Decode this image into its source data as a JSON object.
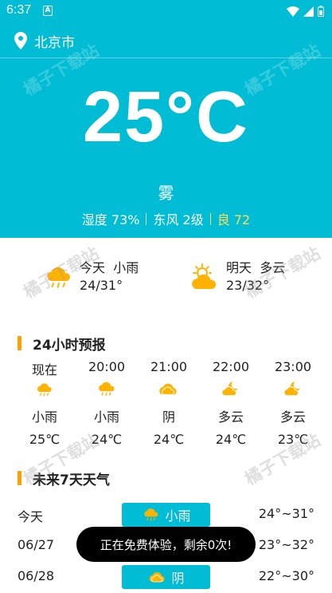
{
  "status_bar": {
    "time": "6:37",
    "notification_letter": "A"
  },
  "header": {
    "city": "北京市",
    "temperature": "25°C",
    "condition": "雾",
    "humidity": "湿度 73%",
    "wind": "东风 2级",
    "aqi": "良 72"
  },
  "forecast_summary": {
    "today": {
      "label": "今天",
      "condition": "小雨",
      "range": "24/31°",
      "icon": "rain-cloud-icon"
    },
    "tomorrow": {
      "label": "明天",
      "condition": "多云",
      "range": "23/32°",
      "icon": "partly-cloudy-sun-icon"
    }
  },
  "hourly": {
    "title": "24小时预报",
    "items": [
      {
        "time": "现在",
        "condition": "小雨",
        "temp": "25℃",
        "icon": "rain-cloud-icon"
      },
      {
        "time": "20:00",
        "condition": "小雨",
        "temp": "24℃",
        "icon": "rain-cloud-icon"
      },
      {
        "time": "21:00",
        "condition": "阴",
        "temp": "24℃",
        "icon": "overcast-cloud-icon"
      },
      {
        "time": "22:00",
        "condition": "多云",
        "temp": "24℃",
        "icon": "partly-cloudy-moon-icon"
      },
      {
        "time": "23:00",
        "condition": "多云",
        "temp": "23℃",
        "icon": "partly-cloudy-moon-icon"
      }
    ]
  },
  "daily": {
    "title": "未来7天天气",
    "items": [
      {
        "date": "今天",
        "condition": "小雨",
        "range": "24°~31°",
        "icon": "rain-cloud-icon"
      },
      {
        "date": "06/27",
        "condition": "",
        "range": "23°~32°",
        "icon": ""
      },
      {
        "date": "06/28",
        "condition": "阴",
        "range": "22°~30°",
        "icon": "overcast-cloud-icon"
      }
    ]
  },
  "toast": {
    "message": "正在免费体验，剩余0次!"
  },
  "watermark": "橘子下载站",
  "colors": {
    "primary": "#00bcd4",
    "accent": "#ffa000",
    "icon_orange": "#ffb300",
    "aqi_yellow": "#ffdd57"
  }
}
